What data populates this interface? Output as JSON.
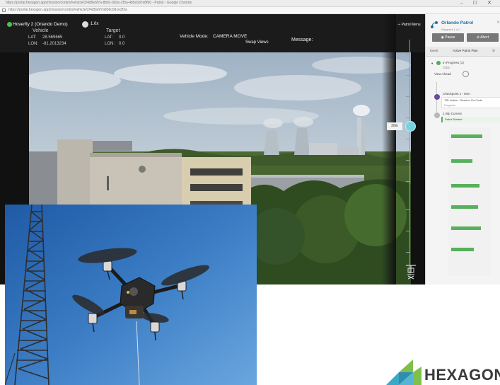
{
  "browser": {
    "title": "https://portal.hexagon.app/mission/control/vehicle/2/4d5e6f7a-8b9c-0d1e-2f3a-4b5c6d7e8f90 - Patrol - Google Chrome",
    "url": "https://portal.hexagon.app/mission/control/vehicle/2/4d5e6f7a8b9c0d1e2f3a"
  },
  "vehicle": {
    "name": "Hoverfly 2 (Orlando Demo)",
    "rate": "1.0x",
    "vehicle_heading": "Vehicle",
    "target_heading": "Target",
    "vehicle_lat_label": "LAT:",
    "vehicle_lat": "28.569665",
    "vehicle_lon_label": "LON:",
    "vehicle_lon": "-81.2013234",
    "target_lat_label": "LAT:",
    "target_lat": "0.0",
    "target_lon_label": "LON:",
    "target_lon": "0.0",
    "mode_label": "Vehicle Mode:",
    "mode_value": "CAMERA MOVE",
    "swap_views": "Swap Views",
    "message_label": "Message:",
    "patrol_menu": "Patrol Menu"
  },
  "altitude": {
    "label": "20m",
    "level": 0.63
  },
  "panel": {
    "title": "Orlando Patrol",
    "subtitle": "Waypoint 1 of 1",
    "buttons": [
      {
        "label": "Pause"
      },
      {
        "label": "Abort"
      }
    ],
    "tabs": [
      {
        "label": "Event"
      },
      {
        "label": "Active Patrol Plan"
      }
    ],
    "in_progress": "In Progress (1)",
    "in_progress_sub": "Orbit",
    "view_label": "View Ahead",
    "waypoint_1": "Checkpoint 1 - item",
    "waypoint_1_note": "TRL Active - Read to Go Code",
    "waypoint_1_note2": "Progress",
    "waypoint_2": "1 Wp Current",
    "waypoint_2_note": "Patrol Started"
  },
  "logo": {
    "text": "HEXAGON",
    "colors": {
      "teal": "#3aa8c9",
      "green": "#7fc04a",
      "dark": "#3b3b3b"
    }
  }
}
